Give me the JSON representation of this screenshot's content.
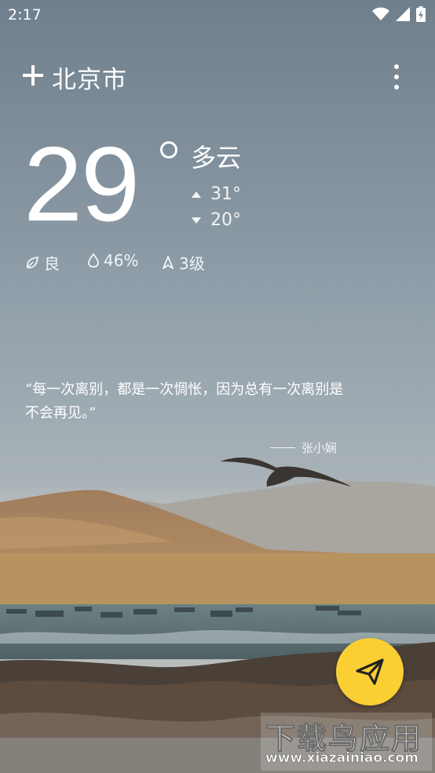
{
  "status_bar": {
    "time": "2:17"
  },
  "header": {
    "city": "北京市"
  },
  "current": {
    "temperature": "29",
    "condition": "多云",
    "high": "31°",
    "low": "20°"
  },
  "details": {
    "air_quality": "良",
    "humidity": "46%",
    "wind": "3级"
  },
  "quote": {
    "text": "“每一次离别，都是一次惆怅，因为总有一次离别是不会再见。”",
    "author": "张小娴"
  },
  "watermark": {
    "title": "下载鸟应用",
    "url": "www.xiazainiao.com"
  },
  "colors": {
    "fab": "#f9cf33",
    "sky": "#8a9aa6",
    "sand": "#b38a5e",
    "sea": "#5f7478"
  },
  "icons": [
    "add-icon",
    "more-vertical-icon",
    "leaf-icon",
    "droplet-icon",
    "wind-icon",
    "send-icon",
    "wifi-icon",
    "signal-icon",
    "battery-icon"
  ]
}
